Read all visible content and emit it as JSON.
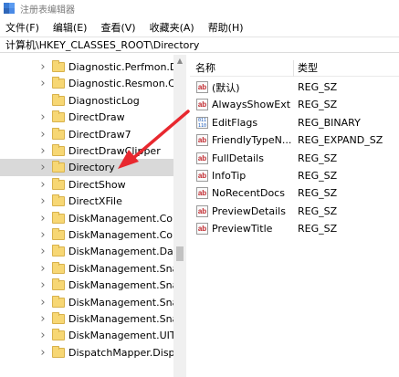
{
  "window": {
    "title": "注册表编辑器"
  },
  "menu": [
    "文件(F)",
    "编辑(E)",
    "查看(V)",
    "收藏夹(A)",
    "帮助(H)"
  ],
  "address": "计算机\\HKEY_CLASSES_ROOT\\Directory",
  "tree": {
    "items": [
      {
        "label": "Diagnostic.Perfmon.D",
        "expandable": true,
        "selected": false
      },
      {
        "label": "Diagnostic.Resmon.C",
        "expandable": true,
        "selected": false
      },
      {
        "label": "DiagnosticLog",
        "expandable": false,
        "selected": false
      },
      {
        "label": "DirectDraw",
        "expandable": true,
        "selected": false
      },
      {
        "label": "DirectDraw7",
        "expandable": true,
        "selected": false
      },
      {
        "label": "DirectDrawClipper",
        "expandable": true,
        "selected": false
      },
      {
        "label": "Directory",
        "expandable": true,
        "selected": true
      },
      {
        "label": "DirectShow",
        "expandable": true,
        "selected": false
      },
      {
        "label": "DirectXFile",
        "expandable": true,
        "selected": false
      },
      {
        "label": "DiskManagement.Cor",
        "expandable": true,
        "selected": false
      },
      {
        "label": "DiskManagement.Cor",
        "expandable": true,
        "selected": false
      },
      {
        "label": "DiskManagement.Dat",
        "expandable": true,
        "selected": false
      },
      {
        "label": "DiskManagement.Sna",
        "expandable": true,
        "selected": false
      },
      {
        "label": "DiskManagement.Sna",
        "expandable": true,
        "selected": false
      },
      {
        "label": "DiskManagement.Sna",
        "expandable": true,
        "selected": false
      },
      {
        "label": "DiskManagement.Sna",
        "expandable": true,
        "selected": false
      },
      {
        "label": "DiskManagement.UIT",
        "expandable": true,
        "selected": false
      },
      {
        "label": "DispatchMapper.Disp",
        "expandable": true,
        "selected": false
      }
    ]
  },
  "list": {
    "headers": {
      "name": "名称",
      "type": "类型"
    },
    "rows": [
      {
        "name": "(默认)",
        "type": "REG_SZ",
        "icon": "string-value-icon"
      },
      {
        "name": "AlwaysShowExt",
        "type": "REG_SZ",
        "icon": "string-value-icon"
      },
      {
        "name": "EditFlags",
        "type": "REG_BINARY",
        "icon": "binary-value-icon"
      },
      {
        "name": "FriendlyTypeN...",
        "type": "REG_EXPAND_SZ",
        "icon": "string-value-icon"
      },
      {
        "name": "FullDetails",
        "type": "REG_SZ",
        "icon": "string-value-icon"
      },
      {
        "name": "InfoTip",
        "type": "REG_SZ",
        "icon": "string-value-icon"
      },
      {
        "name": "NoRecentDocs",
        "type": "REG_SZ",
        "icon": "string-value-icon"
      },
      {
        "name": "PreviewDetails",
        "type": "REG_SZ",
        "icon": "string-value-icon"
      },
      {
        "name": "PreviewTitle",
        "type": "REG_SZ",
        "icon": "string-value-icon"
      }
    ]
  },
  "icons": {
    "string_value": "ab",
    "binary_value": "011\n110"
  },
  "colors": {
    "annotation_arrow": "#e8282f",
    "selection": "#d9d9d9",
    "folder": "#f7d774"
  }
}
